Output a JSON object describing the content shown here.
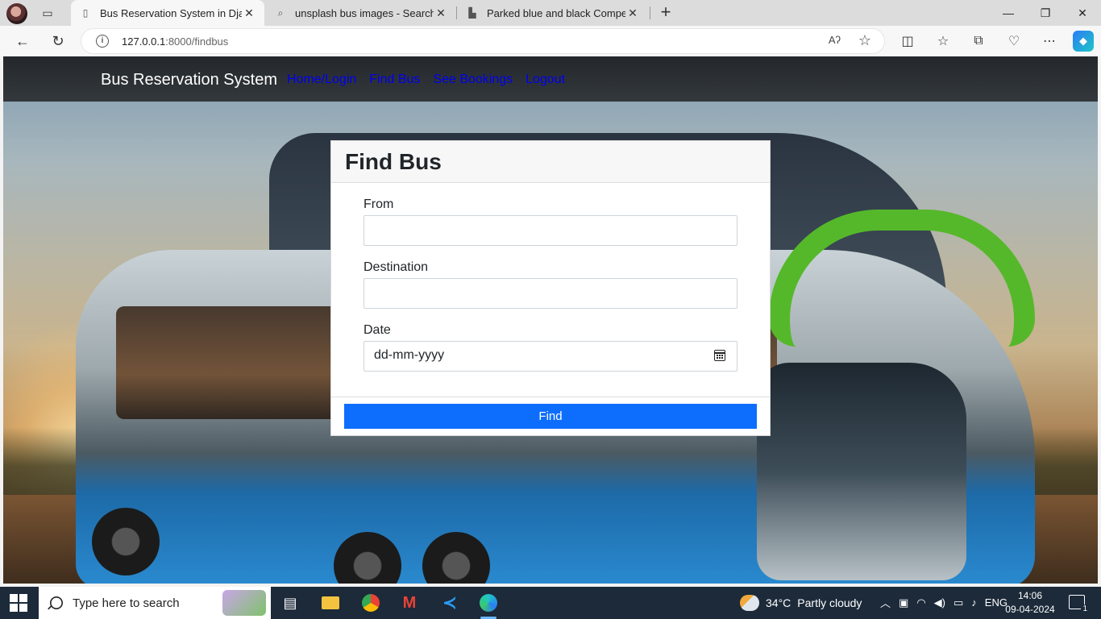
{
  "browser": {
    "tabs": [
      {
        "title": "Bus Reservation System in Djang",
        "active": true
      },
      {
        "title": "unsplash bus images - Search",
        "active": false
      },
      {
        "title": "Parked blue and black Compertu",
        "active": false
      }
    ],
    "url_host": "127.0.0.1",
    "url_path": ":8000/findbus",
    "read_aloud_label": "Aʔ",
    "icons": [
      "profile-avatar",
      "tab-actions-icon",
      "search-icon",
      "image-icon",
      "back-icon",
      "refresh-icon",
      "info-icon",
      "read-aloud-icon",
      "favorite-star-icon",
      "split-screen-icon",
      "favorites-icon",
      "collections-icon",
      "browser-essentials-icon",
      "more-icon",
      "copilot-icon"
    ]
  },
  "site": {
    "brand": "Bus Reservation System",
    "nav": [
      "Home/Login",
      "Find Bus",
      "See Bookings",
      "Logout"
    ]
  },
  "form": {
    "title": "Find Bus",
    "from_label": "From",
    "from_value": "",
    "destination_label": "Destination",
    "destination_value": "",
    "date_label": "Date",
    "date_placeholder": "dd-mm-yyyy",
    "submit_label": "Find"
  },
  "taskbar": {
    "search_placeholder": "Type here to search",
    "weather_temp": "34°C",
    "weather_desc": "Partly cloudy",
    "language": "ENG",
    "time": "14:06",
    "date": "09-04-2024",
    "notification_count": "1",
    "accent": "#0d6efd"
  }
}
